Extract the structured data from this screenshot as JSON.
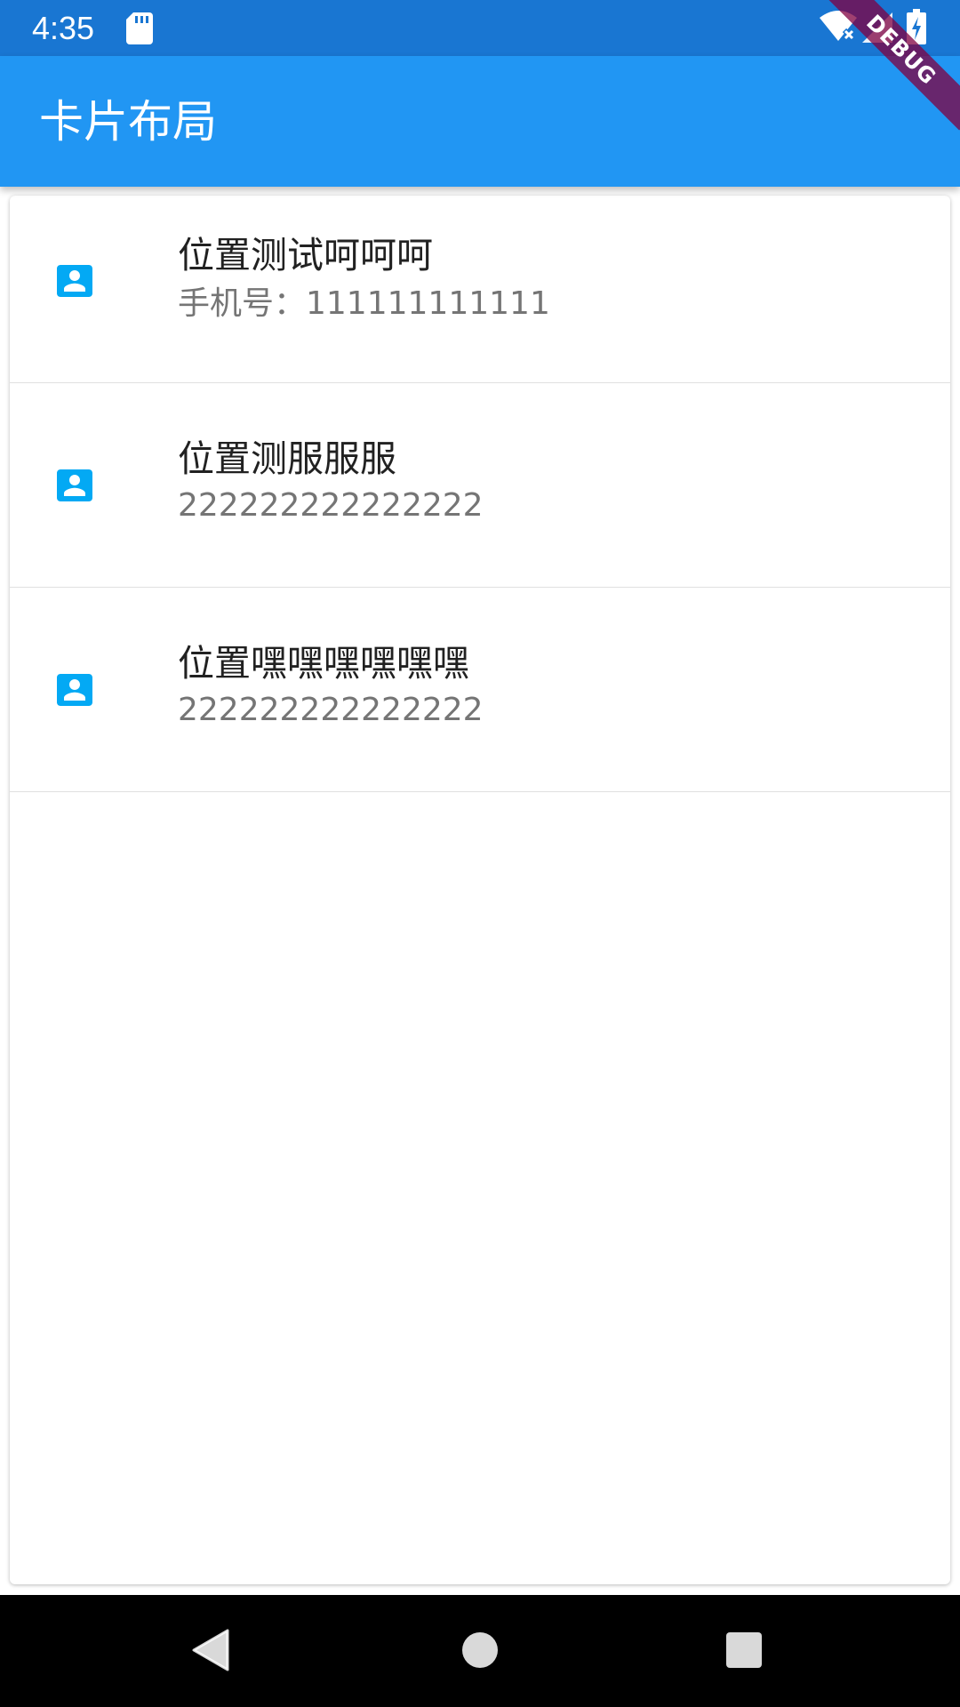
{
  "status_bar": {
    "time": "4:35",
    "icons": [
      "sd-card-icon",
      "wifi-off-icon",
      "signal-icon",
      "battery-charging-icon"
    ],
    "background_color": "#1976D2"
  },
  "app_bar": {
    "title": "卡片布局",
    "background_color": "#2196F3"
  },
  "debug_banner": {
    "label": "DEBUG"
  },
  "list": {
    "icon": "contact-card-icon",
    "icon_color": "#03A9F4",
    "items": [
      {
        "title": "位置测试呵呵呵",
        "subtitle": "手机号：111111111111"
      },
      {
        "title": "位置测服服服",
        "subtitle": "222222222222222"
      },
      {
        "title": "位置嘿嘿嘿嘿嘿嘿",
        "subtitle": "222222222222222"
      }
    ]
  },
  "nav_bar": {
    "buttons": [
      "back-icon",
      "home-icon",
      "recents-icon"
    ]
  }
}
